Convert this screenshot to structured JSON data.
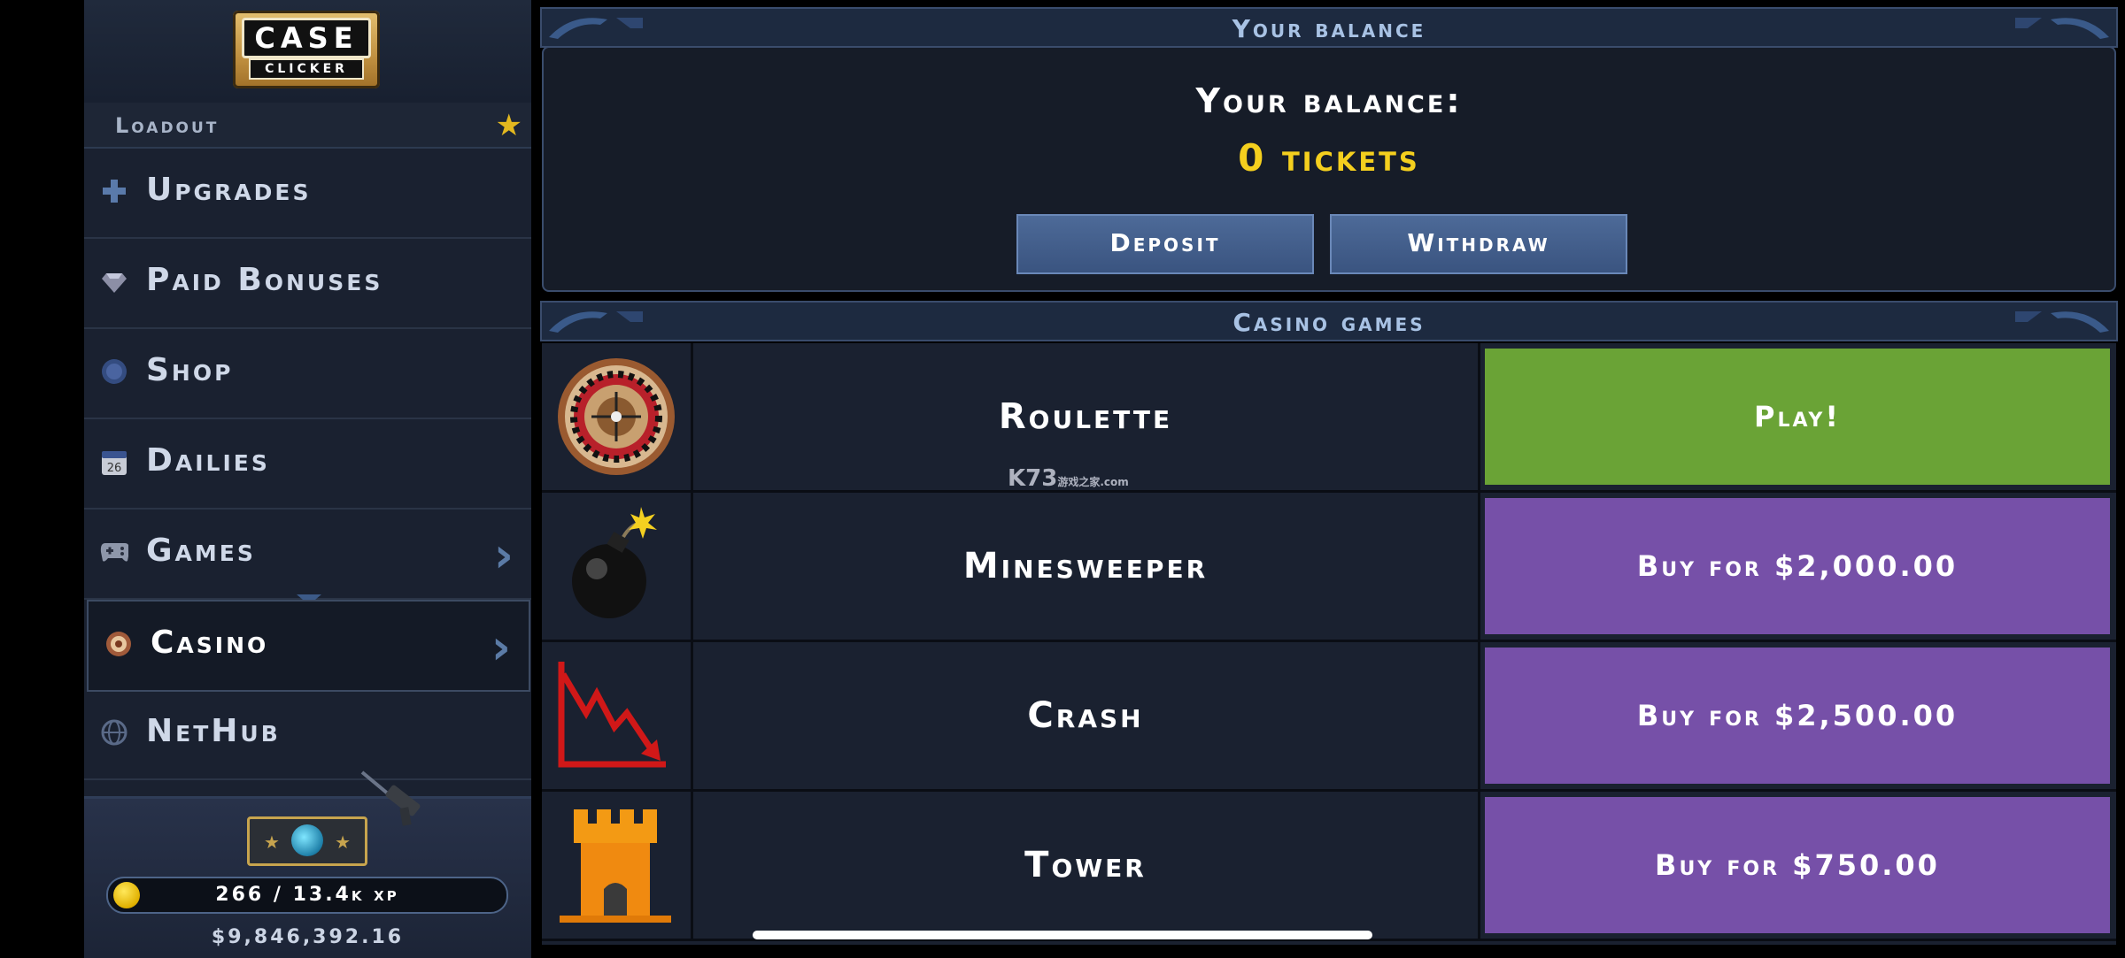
{
  "logo": {
    "line1": "CASE",
    "line2": "CLICKER"
  },
  "sidebar": {
    "loadout_label": "Loadout",
    "items": [
      {
        "label": "Upgrades",
        "icon": "plus-icon"
      },
      {
        "label": "Paid Bonuses",
        "icon": "diamond-icon"
      },
      {
        "label": "Shop",
        "icon": "coin-icon"
      },
      {
        "label": "Dailies",
        "icon": "calendar-icon",
        "calendar_day": "26"
      },
      {
        "label": "Games",
        "icon": "gamepad-icon"
      },
      {
        "label": "Casino",
        "icon": "casino-chip-icon"
      },
      {
        "label": "NetHub",
        "icon": "globe-icon"
      }
    ],
    "active": "Casino"
  },
  "profile": {
    "xp": "266 / 13.4k xp",
    "money": "$9,846,392.16"
  },
  "balance": {
    "header": "Your balance",
    "label": "Your balance:",
    "value": "0 tickets",
    "deposit_label": "Deposit",
    "withdraw_label": "Withdraw"
  },
  "casino": {
    "header": "Casino games",
    "games": [
      {
        "name": "Roulette",
        "action": "Play!",
        "icon": "roulette-icon"
      },
      {
        "name": "Minesweeper",
        "action": "Buy for $2,000.00",
        "icon": "bomb-icon"
      },
      {
        "name": "Crash",
        "action": "Buy for $2,500.00",
        "icon": "crash-chart-icon"
      },
      {
        "name": "Tower",
        "action": "Buy for $750.00",
        "icon": "tower-icon"
      }
    ]
  },
  "watermark": {
    "main": "K73",
    "sub_cn": "游戏之家",
    "sub": ".com"
  },
  "colors": {
    "play_button": "#6aa336",
    "buy_button": "#7650a8",
    "balance_value": "#f4cf1e",
    "sidebar_bg": "#1a2130"
  }
}
